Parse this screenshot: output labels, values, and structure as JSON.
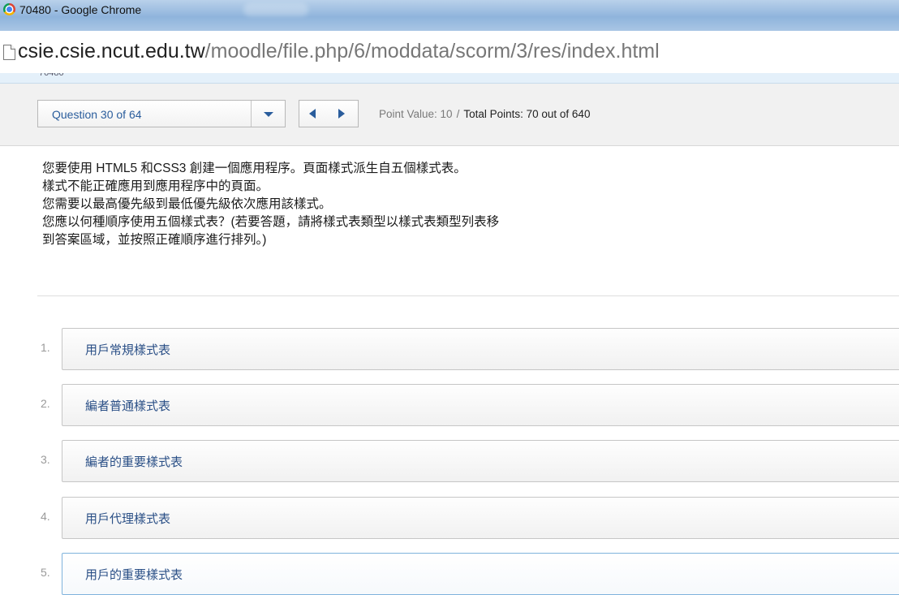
{
  "window": {
    "title": "70480 - Google Chrome",
    "icon": "chrome-icon"
  },
  "address_bar": {
    "domain": "csie.csie.ncut.edu.tw",
    "path": "/moodle/file.php/6/moddata/scorm/3/res/index.html",
    "page_icon": "page-icon"
  },
  "page_header_text": "70480",
  "question_nav": {
    "selector_label": "Question 30 of 64",
    "point_value": "Point Value: 10",
    "separator": "/",
    "total_points": "Total Points: 70 out of 640"
  },
  "question": {
    "lines": [
      "您要使用 HTML5 和CSS3 創建一個應用程序。頁面樣式派生自五個樣式表。",
      "樣式不能正確應用到應用程序中的頁面。",
      "您需要以最高優先級到最低優先級依次應用該樣式。",
      "您應以何種順序使用五個樣式表？(若要答題，請將樣式表類型以樣式表類型列表移",
      "到答案區域，並按照正確順序進行排列。)"
    ]
  },
  "answers": [
    {
      "number": "1.",
      "label": "用戶常規樣式表"
    },
    {
      "number": "2.",
      "label": "編者普通樣式表"
    },
    {
      "number": "3.",
      "label": "編者的重要樣式表"
    },
    {
      "number": "4.",
      "label": "用戶代理樣式表"
    },
    {
      "number": "5.",
      "label": "用戶的重要樣式表"
    }
  ],
  "colors": {
    "accent": "#2a5d9c",
    "answer_text": "#2a4f86",
    "selected_border": "#7fb3dc"
  }
}
